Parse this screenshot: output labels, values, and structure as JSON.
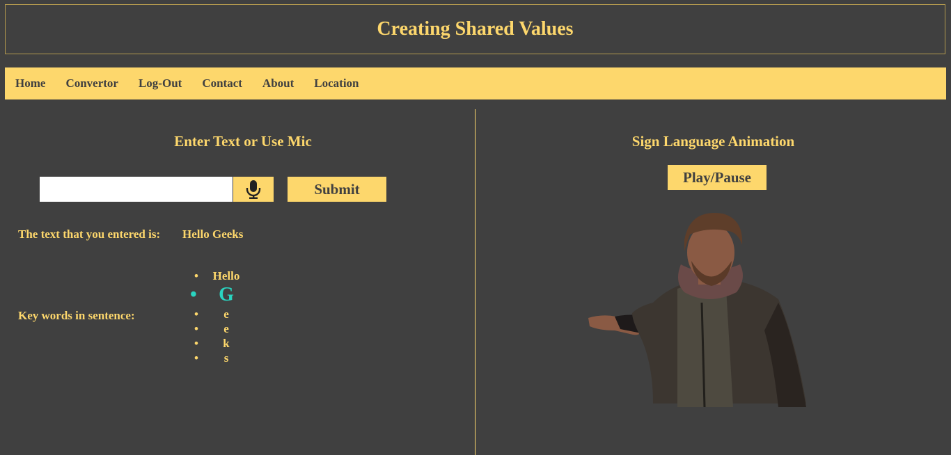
{
  "header": {
    "title": "Creating Shared Values"
  },
  "nav": {
    "items": [
      "Home",
      "Convertor",
      "Log-Out",
      "Contact",
      "About",
      "Location"
    ]
  },
  "left": {
    "title": "Enter Text or Use Mic",
    "input": {
      "value": "",
      "placeholder": ""
    },
    "mic_icon": "microphone-icon",
    "submit_label": "Submit",
    "entered_label": "The text that you entered is:",
    "entered_value": "Hello Geeks",
    "keywords_label": "Key words in sentence:",
    "keywords": [
      "Hello",
      "G",
      "e",
      "e",
      "k",
      "s"
    ],
    "active_keyword_index": 1
  },
  "right": {
    "title": "Sign Language Animation",
    "play_label": "Play/Pause"
  },
  "colors": {
    "background": "#404040",
    "accent": "#fdd76c",
    "highlight": "#2ad4c0"
  }
}
